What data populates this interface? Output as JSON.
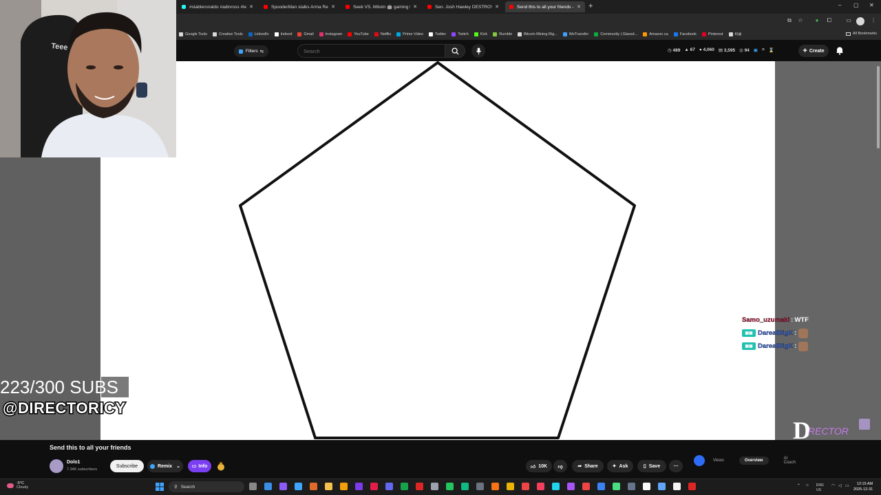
{
  "browser": {
    "tabs": [
      {
        "title": "#stableronaldo #adinross #lebr",
        "color": "#25f4ee",
        "active": false
      },
      {
        "title": "SpooderMan stalks Arma Refor",
        "color": "#ff0000",
        "active": false
      },
      {
        "title": "Seek VS. Milsim 🤖 gaming fun",
        "color": "#ff0000",
        "active": false
      },
      {
        "title": "Sen. Josh Hawley DESTROYS C",
        "color": "#ff0000",
        "active": false
      },
      {
        "title": "Send this to all your friends - Yo",
        "color": "#ff0000",
        "active": true
      }
    ],
    "new_tab": "+",
    "window_controls": [
      "–",
      "▢",
      "✕"
    ]
  },
  "bookmarks": {
    "items": [
      {
        "label": "Google Tools",
        "color": "#d9d9d9"
      },
      {
        "label": "Creative Tools",
        "color": "#d9d9d9"
      },
      {
        "label": "LinkedIn",
        "color": "#0a66c2"
      },
      {
        "label": "Indeed",
        "color": "#ffffff"
      },
      {
        "label": "Gmail",
        "color": "#ea4335"
      },
      {
        "label": "Instagram",
        "color": "#e1306c"
      },
      {
        "label": "YouTube",
        "color": "#ff0000"
      },
      {
        "label": "Netflix",
        "color": "#e50914"
      },
      {
        "label": "Prime Video",
        "color": "#00a8e1"
      },
      {
        "label": "Twitter",
        "color": "#ffffff"
      },
      {
        "label": "Twitch",
        "color": "#9146ff"
      },
      {
        "label": "Kick",
        "color": "#53fc18"
      },
      {
        "label": "Rumble",
        "color": "#85c742"
      },
      {
        "label": "Bitcoin Mining Rig...",
        "color": "#d9d9d9"
      },
      {
        "label": "WeTransfer",
        "color": "#409fff"
      },
      {
        "label": "Community | Glassd...",
        "color": "#0caa41"
      },
      {
        "label": "Amazon.ca",
        "color": "#ff9900"
      },
      {
        "label": "Facebook",
        "color": "#1877f2"
      },
      {
        "label": "Pinterest",
        "color": "#e60023"
      },
      {
        "label": "Kijiji",
        "color": "#d9d9d9"
      }
    ],
    "all_label": "All Bookmarks"
  },
  "youtube": {
    "filters_label": "Filters",
    "search_placeholder": "Search",
    "stats": [
      "489",
      "67",
      "4,060",
      "3,595",
      "94"
    ],
    "create_label": "Create"
  },
  "overlay": {
    "subs_goal": "223/300 SUBS",
    "handle": "@DIRECTORICY",
    "logo_text": "DIRECTOR ICY",
    "chat": [
      {
        "user": "Samo_uzumaki",
        "sep": ":",
        "msg": "WTF",
        "style": "red"
      },
      {
        "user": "DarealBigK",
        "sep": ":",
        "msg": "",
        "style": "blue"
      },
      {
        "user": "DarealBigK",
        "sep": ":",
        "msg": "",
        "style": "blue"
      }
    ]
  },
  "video": {
    "title": "Send this to all your friends",
    "channel": "Dolo1",
    "subscribers": "7.34K subscribers",
    "subscribe_label": "Subscribe",
    "remix_label": "Remix",
    "info_label": "Info",
    "likes": "10K",
    "share_label": "Share",
    "ask_label": "Ask",
    "save_label": "Save",
    "tabs": [
      "Views",
      "Overview",
      "AI Coach"
    ]
  },
  "taskbar": {
    "weather_temp": "-5°C",
    "weather_desc": "Cloudy",
    "search_label": "Search",
    "lang_top": "ENG",
    "lang_bottom": "US",
    "time": "12:15 AM",
    "date": "2025-12-31"
  }
}
